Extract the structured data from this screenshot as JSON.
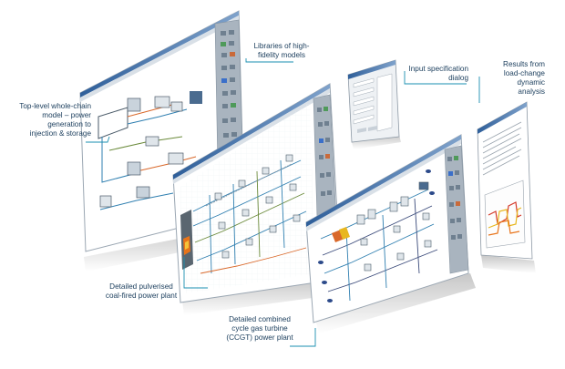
{
  "callouts": {
    "top_level": {
      "lines": [
        "Top-level whole-chain",
        "model – power",
        "generation to",
        "injection & storage"
      ]
    },
    "libraries": {
      "lines": [
        "Libraries of high-",
        "fidelity models"
      ]
    },
    "input_spec": {
      "lines": [
        "Input specification",
        "dialog"
      ]
    },
    "results": {
      "lines": [
        "Results from",
        "load-change",
        "dynamic",
        "analysis"
      ]
    },
    "pulverised": {
      "lines": [
        "Detailed pulverised",
        "coal-fired power plant"
      ]
    },
    "ccgt": {
      "lines": [
        "Detailed combined",
        "cycle gas turbine",
        "(CCGT) power plant"
      ]
    }
  },
  "colors": {
    "accent": "#1a8fb0",
    "callout_text": "#1a3d5c",
    "window_frame": "#b8c3ce",
    "titlebar": "#3d6ea8",
    "palette": "#a9b4bf",
    "chart_red": "#d43a2a",
    "chart_yellow": "#e8b71f",
    "chart_orange": "#e8741a"
  }
}
